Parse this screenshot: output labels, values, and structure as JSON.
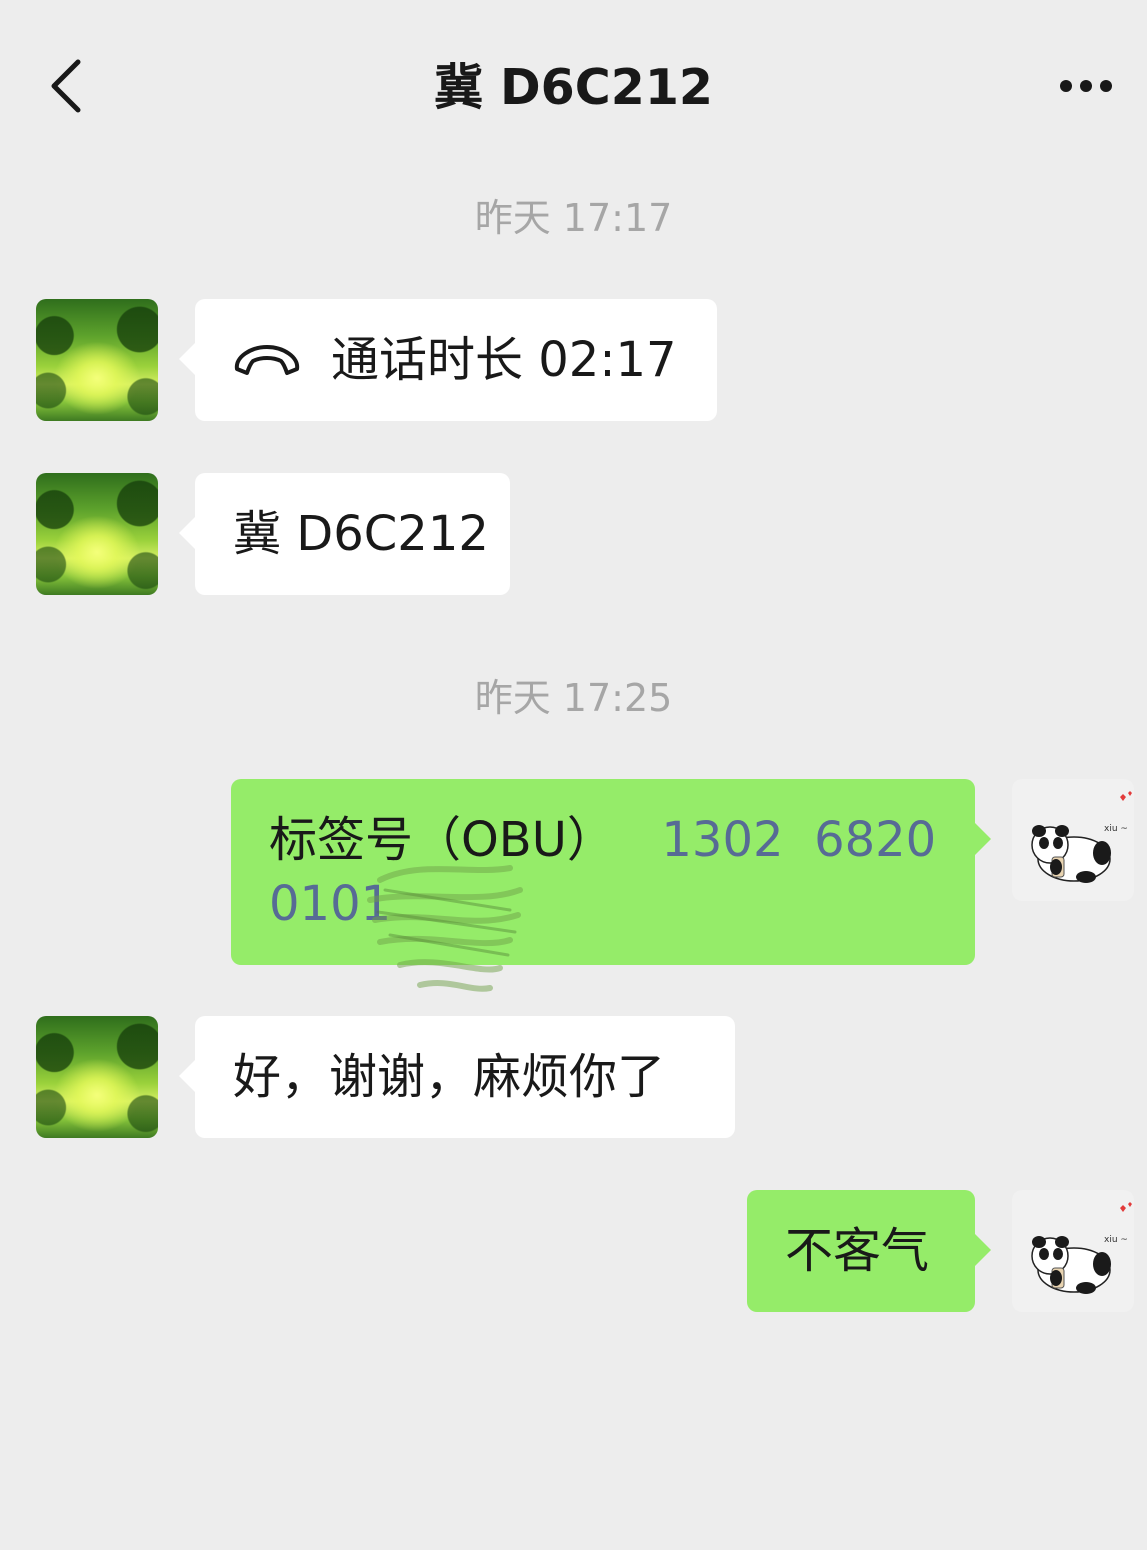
{
  "header": {
    "title": "冀 D6C212",
    "back_icon": "chevron-left-icon",
    "more_icon": "ellipsis-icon"
  },
  "messages": [
    {
      "type": "timestamp",
      "text": "昨天 17:17"
    },
    {
      "type": "call",
      "side": "in",
      "icon": "phone-hangup-icon",
      "text": "通话时长 02:17"
    },
    {
      "type": "text",
      "side": "in",
      "text": "冀 D6C212"
    },
    {
      "type": "timestamp",
      "text": "昨天 17:25"
    },
    {
      "type": "text",
      "side": "out",
      "label": "标签号（OBU）",
      "number_line1": "1302  6820",
      "number_line2": "0101"
    },
    {
      "type": "text",
      "side": "in",
      "text": "好，谢谢，麻烦你了"
    },
    {
      "type": "text",
      "side": "out",
      "text": "不客气"
    }
  ],
  "avatars": {
    "contact": "forest-path-avatar",
    "self": "panda-sticker-avatar",
    "self_caption": "xiu ~"
  },
  "colors": {
    "background": "#ededed",
    "incoming_bubble": "#ffffff",
    "outgoing_bubble": "#95ec69",
    "timestamp_text": "#a6a6a6",
    "link_text": "#576b95"
  }
}
